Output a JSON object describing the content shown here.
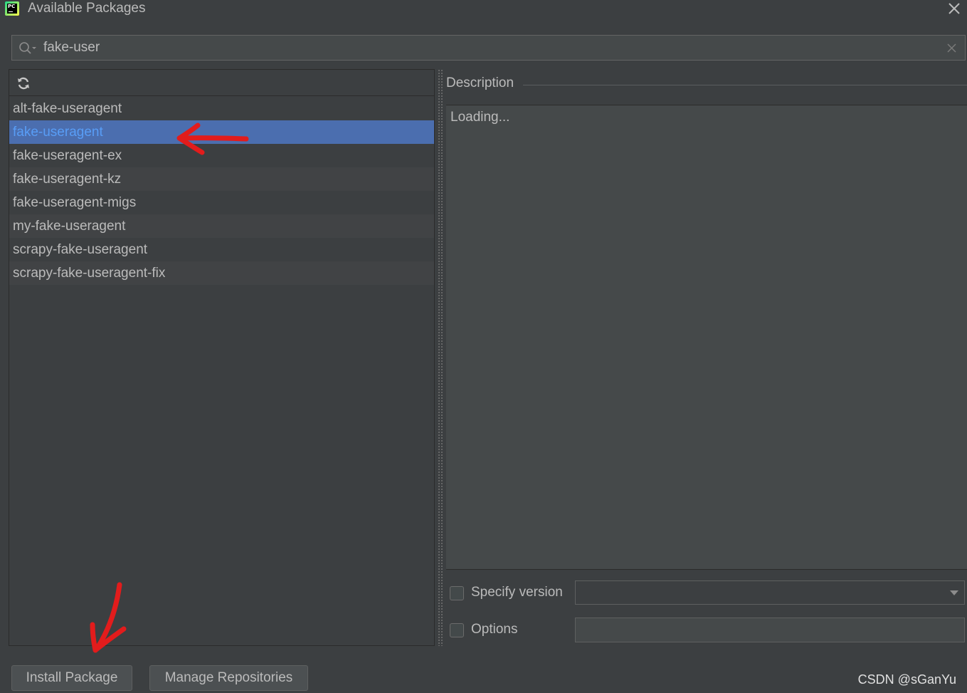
{
  "window": {
    "title": "Available Packages",
    "logo_text": "PC"
  },
  "search": {
    "value": "fake-user",
    "placeholder": ""
  },
  "packages": {
    "selected_index": 1,
    "items": [
      "alt-fake-useragent",
      "fake-useragent",
      "fake-useragent-ex",
      "fake-useragent-kz",
      "fake-useragent-migs",
      "my-fake-useragent",
      "scrapy-fake-useragent",
      "scrapy-fake-useragent-fix"
    ]
  },
  "description": {
    "title": "Description",
    "body": "Loading..."
  },
  "options": {
    "specify_version_label": "Specify version",
    "specify_version_checked": false,
    "version_value": "",
    "options_label": "Options",
    "options_checked": false,
    "options_value": ""
  },
  "buttons": {
    "install_label": "Install Package",
    "manage_label": "Manage Repositories"
  },
  "watermark": "CSDN @sGanYu",
  "colors": {
    "background": "#3c3f41",
    "selection": "#4b6eaf",
    "selected_text": "#589df6",
    "annotation": "#e21c1c"
  }
}
